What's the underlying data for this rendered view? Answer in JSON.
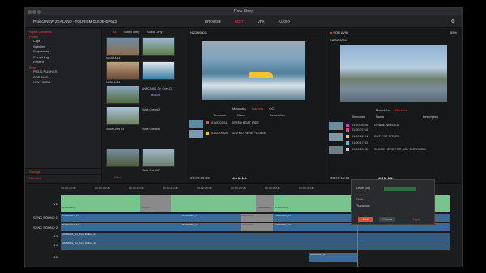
{
  "window": {
    "title": "Flow Story"
  },
  "menu": {
    "project": "Project NEW ZEALAND - TOURISM GUIDE-EP613",
    "modes": [
      "BROWSE",
      "EDIT",
      "VFX",
      "AUDIO"
    ],
    "active_mode": "EDIT"
  },
  "sidebar": {
    "heading": "Project Contents",
    "filters_label": "Filters",
    "filters": [
      "Clips",
      "Subclips",
      "Sequences",
      "Everything",
      "Recent"
    ],
    "bins_label": "Bins",
    "bins": [
      "FIELD RUSHES",
      "FOR AVID",
      "NEW SUBS"
    ],
    "storage": "Storage",
    "libraries": "Libraries"
  },
  "bin": {
    "tabs": [
      "All",
      "Video Only",
      "Audio Only"
    ],
    "active_tab": "All",
    "items": [
      "N2DD0014",
      "NZDD1401",
      "NZDD2416",
      "ANNC0490_05_Grey-G",
      "Bound",
      "Voice Over #2",
      "Voice Over #3",
      "Voice Over #5",
      "Voice Over #7",
      "Office"
    ]
  },
  "source_viewer": {
    "clip": "NZDD0801",
    "tabs": [
      "Metadata",
      "Markers",
      "QC"
    ],
    "active_tab": "Markers",
    "columns": [
      "Timecode",
      "Name",
      "Description"
    ],
    "markers": [
      {
        "tc": "01:00:02:11",
        "name": "SPEED BOAT RIDE",
        "color": "#e24a3a"
      },
      {
        "tc": "01:00:05:20",
        "name": "SLO MO HERE PLEASE",
        "color": "#f0c030"
      }
    ],
    "timecode": "00:00:00:00"
  },
  "record_viewer": {
    "label": "FOR AVID",
    "clip": "NZDD0801",
    "zoom": "59%",
    "tabs": [
      "Metadata",
      "Markers"
    ],
    "active_tab": "Markers",
    "columns": [
      "Timecode",
      "Name",
      "Description"
    ],
    "markers": [
      {
        "tc": "01:00:04:05",
        "name": "GRADE NEEDED",
        "color": "#c040c0"
      },
      {
        "tc": "01:00:07:10",
        "name": "",
        "color": "#e04080"
      },
      {
        "tc": "01:00:12:24",
        "name": "CUT FOR TITLES",
        "color": "#f0c030"
      },
      {
        "tc": "01:00:17:02",
        "name": "",
        "color": "#40c0e0"
      },
      {
        "tc": "01:00:20:05",
        "name": "CLOSE HERE FOR BOY DISTROBU..",
        "color": "#d0d0d0"
      }
    ],
    "timecode": "00:00:11:01"
  },
  "timeline": {
    "ruler": [
      "00:00:00:00",
      "00:00:05:00",
      "00:00:10:00",
      "00:00:15:00",
      "00:00:20:00",
      "00:00:25:00",
      "00:00:30:00",
      "00:00:35:00"
    ],
    "tracks": [
      "V1",
      "SYNC SOUND 1",
      "SYNC SOUND 2",
      "A3",
      "A4",
      "A5"
    ],
    "v1_clips": [
      "NZDD0801",
      "Dissolve",
      "NZDD0802",
      "NZDD0201"
    ],
    "sync1_clips": [
      "NZDD0201_A1",
      "NZDD0801_A1",
      "Crossfade",
      "NZDD0802_A1"
    ],
    "sync2_clips": [
      "NZDD0201_A2",
      "NZDD0801_A2",
      "Crossfade",
      "NZDD0802_A2"
    ],
    "a3_clip": "AMB0701_5H_Tung Dulbet_A1",
    "a4_clip": "AMB0701_5H_Tung Dulbet_A2",
    "a5_clip": "NZDD0001_A1"
  },
  "popup": {
    "title": "Level (dB)",
    "rows": [
      "Fade",
      "Transition"
    ],
    "end_label": "End",
    "cancel_label": "Cancel",
    "apply_label": "Apply"
  },
  "colors": {
    "accent": "#e24a3a",
    "video_clip": "#79c48c",
    "audio_clip": "#3d6a94"
  }
}
